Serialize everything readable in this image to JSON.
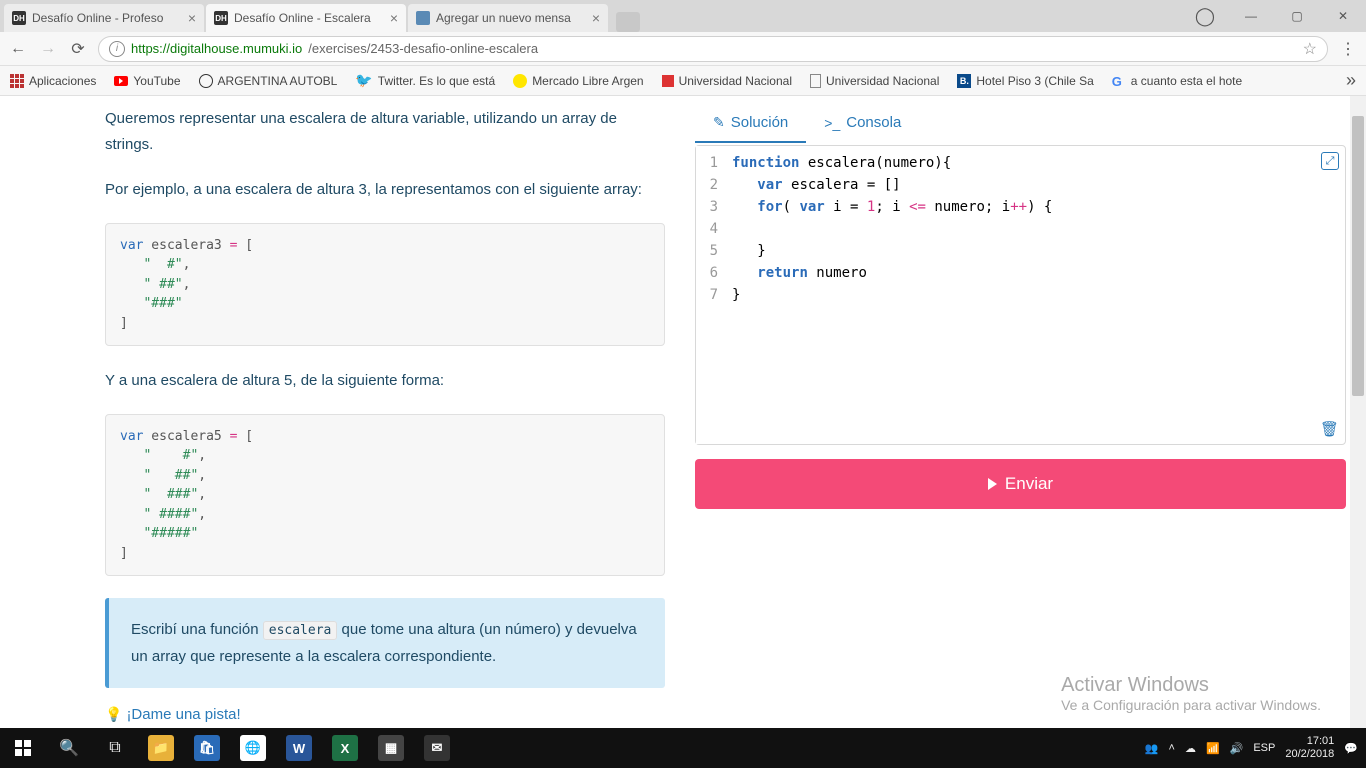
{
  "tabs": [
    {
      "title": "Desafío Online - Profeso"
    },
    {
      "title": "Desafío Online - Escalera"
    },
    {
      "title": "Agregar un nuevo mensa"
    }
  ],
  "url": {
    "host": "https://digitalhouse.mumuki.io",
    "path": "/exercises/2453-desafio-online-escalera"
  },
  "bookmarks": {
    "apps": "Aplicaciones",
    "yt": "YouTube",
    "arg": "ARGENTINA AUTOBL",
    "tw": "Twitter. Es lo que está",
    "ml": "Mercado Libre Argen",
    "un1": "Universidad Nacional",
    "un2": "Universidad Nacional",
    "hotel": "Hotel Piso 3 (Chile Sa",
    "g": "a cuanto esta el hote"
  },
  "problem": {
    "p1": "Queremos representar una escalera de altura variable, utilizando un array de strings.",
    "p2": "Por ejemplo, a una escalera de altura 3, la representamos con el siguiente array:",
    "p3": "Y a una escalera de altura 5, de la siguiente forma:",
    "hint1": "Escribí una función ",
    "hintcode": "escalera",
    "hint2": " que tome una altura (un número) y devuelva un array que represente a la escalera correspondiente.",
    "pista": "¡Dame una pista!"
  },
  "editor_tabs": {
    "solucion": "Solución",
    "consola": "Consola"
  },
  "code": {
    "l1a": "function",
    "l1b": " escalera(numero){",
    "l2a": "var",
    "l2b": " escalera = []",
    "l3a": "for",
    "l3b": "( ",
    "l3c": "var",
    "l3d": " i = ",
    "l3e": "1",
    "l3f": "; i ",
    "l3g": "<=",
    "l3h": " numero; i",
    "l3i": "++",
    "l3j": ") {",
    "l5": "   }",
    "l6a": "return",
    "l6b": " numero",
    "l7": "}"
  },
  "submit": "Enviar",
  "watermark": {
    "t1": "Activar Windows",
    "t2": "Ve a Configuración para activar Windows."
  },
  "clock": {
    "time": "17:01",
    "date": "20/2/2018",
    "lang": "ESP"
  }
}
